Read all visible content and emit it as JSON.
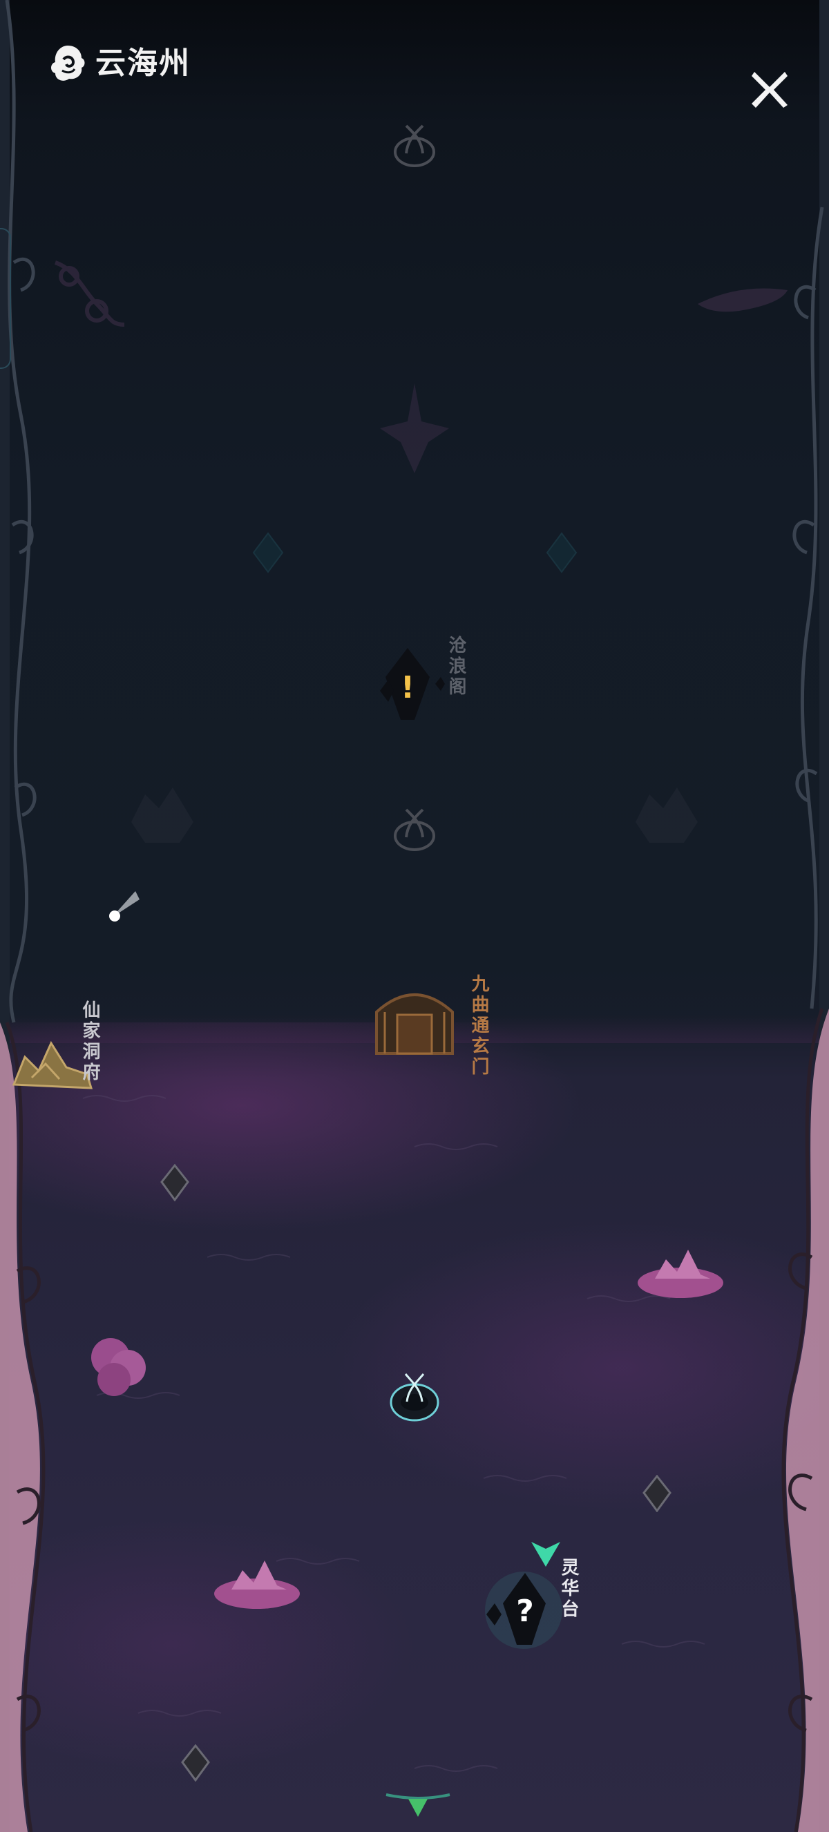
{
  "header": {
    "title": "云海州",
    "logo_icon": "cloud-emblem-icon",
    "close_icon": "close-x-icon"
  },
  "map": {
    "locations": [
      {
        "id": "canglang",
        "label": "沧浪阁",
        "marker": "exclamation-quest-icon",
        "quest_symbol": "!"
      },
      {
        "id": "jiuqu",
        "label": "九曲通玄门"
      },
      {
        "id": "xianjia",
        "label": "仙家洞府"
      },
      {
        "id": "linghua",
        "label": "灵华台",
        "marker": "question-quest-icon",
        "quest_symbol": "?"
      }
    ]
  },
  "colors": {
    "accent_green": "#3fd8a8",
    "quest_yellow": "#f4c24a",
    "sea_purple": "#a2508f",
    "ink_dark": "#101014"
  }
}
